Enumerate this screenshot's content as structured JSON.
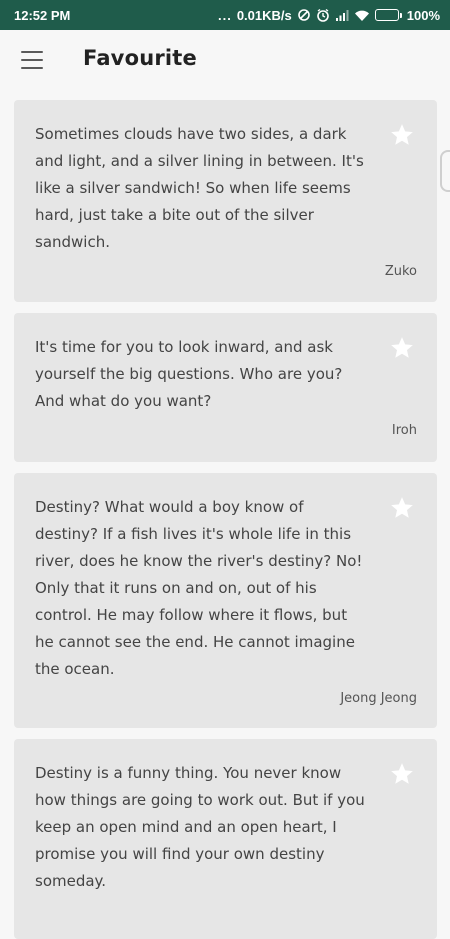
{
  "status_bar": {
    "time": "12:52 PM",
    "dots": "...",
    "network_speed": "0.01KB/s",
    "battery_percent": "100%",
    "battery_level": 1.0,
    "icons": [
      "data-saver-icon",
      "alarm-icon",
      "signal-icon",
      "wifi-icon",
      "battery-icon"
    ]
  },
  "app_bar": {
    "title": "Favourite",
    "menu_icon": "hamburger-menu-icon"
  },
  "cards": [
    {
      "quote": "Sometimes clouds have two sides, a dark and light, and a silver lining in between. It's like a silver sandwich! So when life seems hard, just take a bite out of the silver sandwich.",
      "author": "Zuko",
      "favourite_icon": "star-icon"
    },
    {
      "quote": "It's time for you to look inward, and ask yourself the big questions. Who are you? And what do you want?",
      "author": "Iroh",
      "favourite_icon": "star-icon"
    },
    {
      "quote": "Destiny? What would a boy know of destiny? If a fish lives it's whole life in this river, does he know the river's destiny? No! Only that it runs on and on, out of his control. He may follow where it flows, but he cannot see the end. He cannot imagine the ocean.",
      "author": "Jeong Jeong",
      "favourite_icon": "star-icon"
    },
    {
      "quote": "Destiny is a funny thing. You never know how things are going to work out. But if you keep an open mind and an open heart, I promise you will find your own destiny someday.",
      "author": "",
      "favourite_icon": "star-icon"
    }
  ],
  "colors": {
    "status_bar": "#1f5c4b",
    "background": "#f7f7f7",
    "card": "#e6e6e6",
    "star": "#ffffff"
  }
}
